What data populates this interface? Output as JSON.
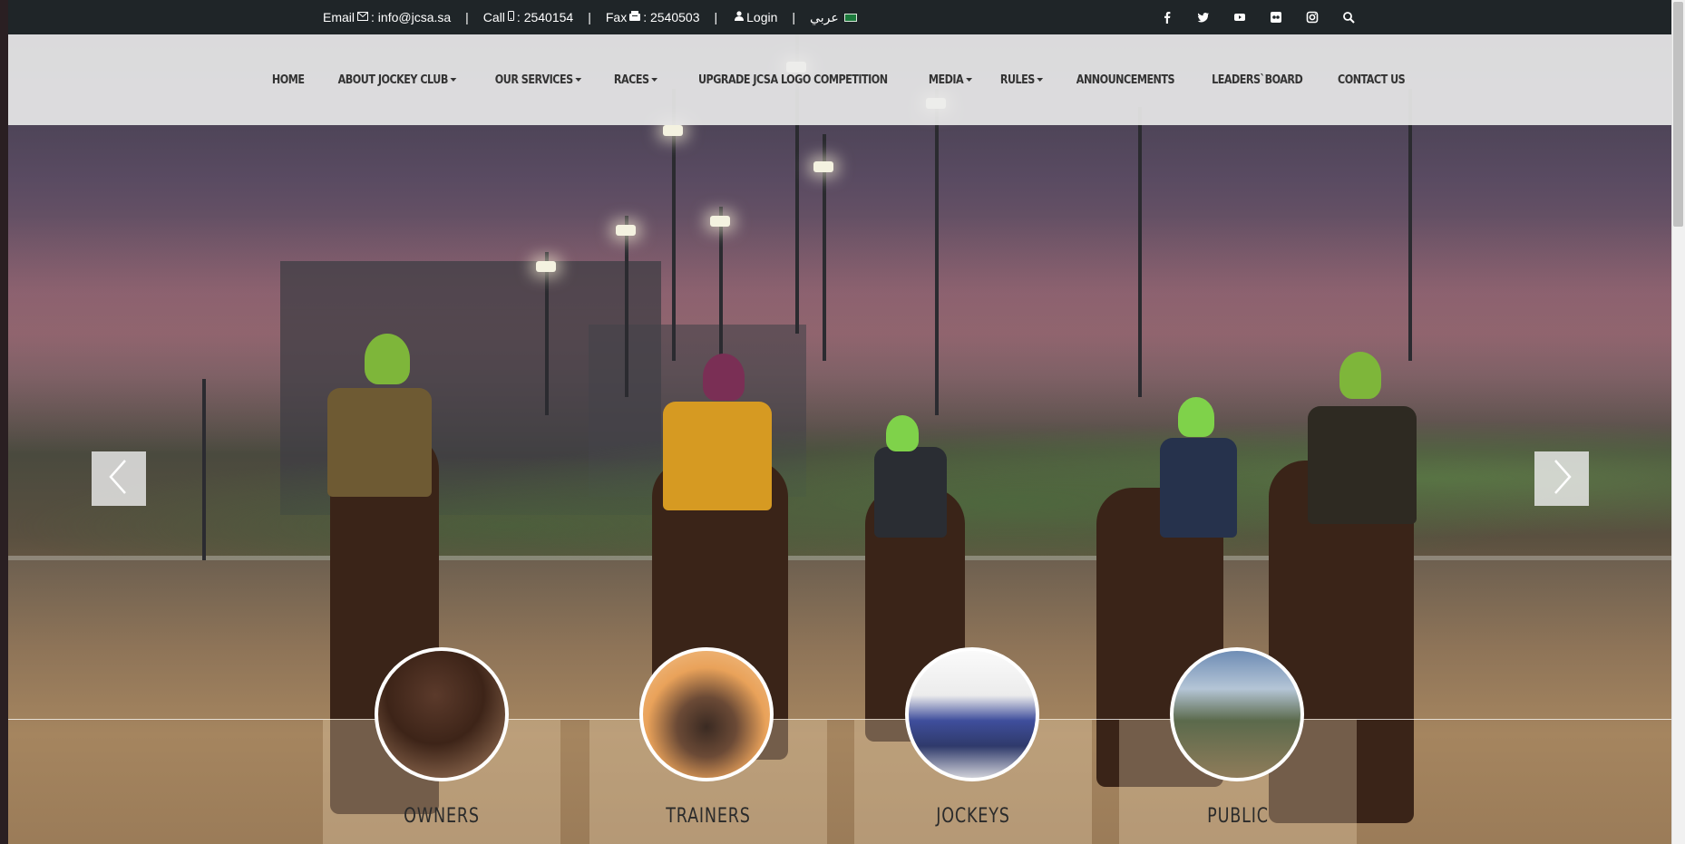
{
  "topbar": {
    "email_label": "Email",
    "email_value": ": info@jcsa.sa",
    "call_label": "Call",
    "call_value": ": 2540154",
    "fax_label": "Fax",
    "fax_value": ": 2540503",
    "login_label": "Login",
    "language_label": "عربي",
    "separator": "|",
    "social_icons": [
      "facebook-icon",
      "twitter-icon",
      "youtube-icon",
      "flickr-icon",
      "instagram-icon",
      "search-icon"
    ]
  },
  "nav": {
    "items": [
      {
        "label": "HOME",
        "dropdown": false
      },
      {
        "label": "ABOUT JOCKEY CLUB",
        "dropdown": true
      },
      {
        "label": "OUR SERVICES",
        "dropdown": true
      },
      {
        "label": "RACES",
        "dropdown": true
      },
      {
        "label": "UPGRADE JCSA LOGO COMPETITION",
        "dropdown": false
      },
      {
        "label": "MEDIA",
        "dropdown": true
      },
      {
        "label": "RULES",
        "dropdown": true
      },
      {
        "label": "ANNOUNCEMENTS",
        "dropdown": false
      },
      {
        "label": "LEADERS`BOARD",
        "dropdown": false
      },
      {
        "label": "CONTACT US",
        "dropdown": false
      }
    ]
  },
  "carousel": {
    "prev_icon": "chevron-left-icon",
    "next_icon": "chevron-right-icon"
  },
  "cards": [
    {
      "label": "OWNERS"
    },
    {
      "label": "TRAINERS"
    },
    {
      "label": "JOCKEYS"
    },
    {
      "label": "PUBLIC"
    }
  ],
  "colors": {
    "topbar_bg": "#1f2528",
    "nav_bg": "#ececec",
    "nav_text": "#333333"
  }
}
